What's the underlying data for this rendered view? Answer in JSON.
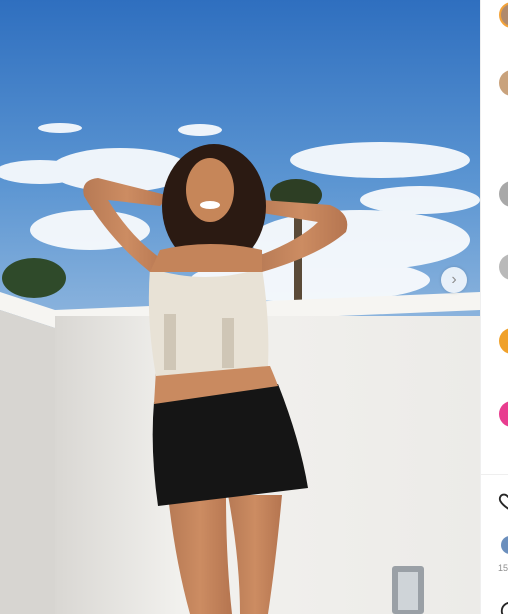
{
  "post": {
    "image_description_icon": "photo",
    "next_icon": "chevron-right-icon",
    "next_glyph": "›"
  },
  "sidebar": {
    "avatars": [
      {
        "name": "avatar-profile",
        "color": "#b08a6d"
      },
      {
        "name": "avatar-commenter-1",
        "color": "#c9a27c"
      },
      {
        "name": "avatar-commenter-2",
        "color": "#a8a8a8"
      },
      {
        "name": "avatar-commenter-3",
        "color": "#b9b9b9"
      },
      {
        "name": "avatar-commenter-4",
        "color": "#f0a12a"
      },
      {
        "name": "avatar-commenter-5",
        "color": "#e83d8f"
      },
      {
        "name": "avatar-liker",
        "color": "#6b8fbd"
      }
    ],
    "likes_text": "15",
    "icons": [
      "heart-icon",
      "comment-icon"
    ]
  },
  "colors": {
    "sky": "#3f7ec8",
    "wall": "#efeeec",
    "skirt": "#141414",
    "top": "#e8e2d6"
  }
}
